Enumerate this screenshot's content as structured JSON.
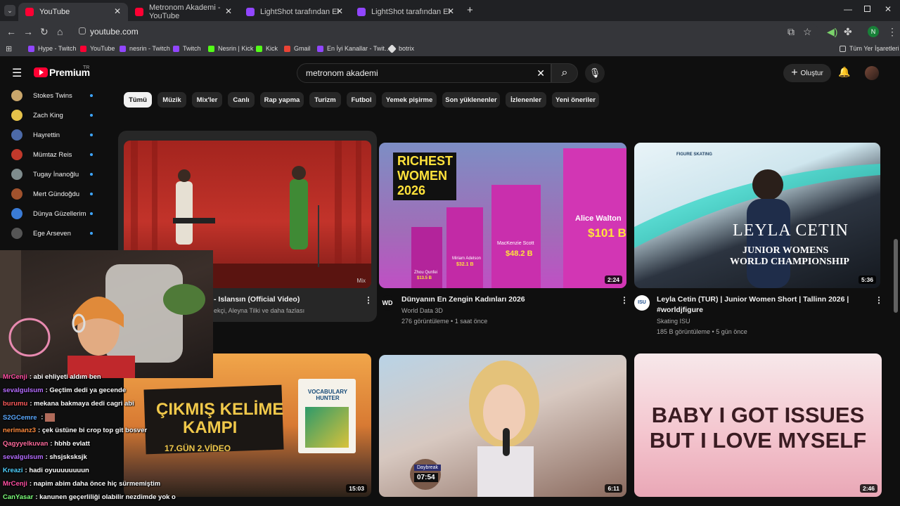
{
  "browser": {
    "tabs": [
      {
        "label": "YouTube",
        "color": "#ff0033",
        "active": true
      },
      {
        "label": "Metronom Akademi - YouTube",
        "color": "#ff0033",
        "active": false
      },
      {
        "label": "LightShot tarafından Ekran Gör…",
        "color": "#9146ff",
        "active": false
      },
      {
        "label": "LightShot tarafından Ekran Gör…",
        "color": "#9146ff",
        "active": false
      }
    ],
    "url": "youtube.com",
    "profile_initial": "N",
    "bookmarks": [
      {
        "label": "Hype - Twitch",
        "color": "#9146ff"
      },
      {
        "label": "YouTube",
        "color": "#ff0033"
      },
      {
        "label": "nesrin - Twitch",
        "color": "#9146ff"
      },
      {
        "label": "Twitch",
        "color": "#9146ff"
      },
      {
        "label": "Nesrin | Kick",
        "color": "#53fc18"
      },
      {
        "label": "Kick",
        "color": "#53fc18"
      },
      {
        "label": "Gmail",
        "color": "#ea4335"
      },
      {
        "label": "En İyi Kanallar - Twit…",
        "color": "#9146ff"
      },
      {
        "label": "botrix",
        "color": "#dddddd"
      }
    ],
    "all_bookmarks": "Tüm Yer İşaretleri"
  },
  "header": {
    "logo": "Premium",
    "country": "TR",
    "search_value": "metronom akademi",
    "create_label": "Oluştur"
  },
  "chips": [
    "Tümü",
    "Müzik",
    "Mix'ler",
    "Canlı",
    "Rap yapma",
    "Turizm",
    "Futbol",
    "Yemek pişirme",
    "Son yüklenenler",
    "İzlenenler",
    "Yeni öneriler"
  ],
  "sidebar": {
    "items": [
      {
        "label": "Stokes Twins",
        "color": "#c9a66b"
      },
      {
        "label": "Zach King",
        "color": "#e6c34a"
      },
      {
        "label": "Hayrettin",
        "color": "#4c6aa8"
      },
      {
        "label": "Mümtaz Reis",
        "color": "#c0392b"
      },
      {
        "label": "Tugay İnanoğlu",
        "color": "#7f8c8d"
      },
      {
        "label": "Mert Gündoğdu",
        "color": "#a0522d"
      },
      {
        "label": "Dünya Güzellerim",
        "color": "#3a7bd5"
      },
      {
        "label": "Ege Arseven",
        "color": "#555555"
      }
    ]
  },
  "videos": [
    {
      "title": "- Islansın (Official Video)",
      "channel": "",
      "meta": "ekçi, Aleyna Tilki ve daha fazlası",
      "duration": "",
      "badge": "Mix"
    },
    {
      "title": "Dünyanın En Zengin Kadınları 2026",
      "channel": "World Data 3D",
      "meta": "276 görüntüleme • 1 saat önce",
      "duration": "2:24",
      "channel_icon": "WD"
    },
    {
      "title": "Leyla Cetin (TUR) | Junior Women Short | Tallinn 2026 | #worldjfigure",
      "channel": "Skating ISU",
      "meta": "185 B görüntüleme • 5 gün önce",
      "duration": "5:36",
      "channel_icon": "ISU"
    },
    {
      "title": "",
      "channel": "",
      "meta": "",
      "duration": "15:03"
    },
    {
      "title": "",
      "channel": "",
      "meta": "",
      "duration": "6:11"
    },
    {
      "title": "",
      "channel": "",
      "meta": "",
      "duration": "2:46"
    }
  ],
  "thumb_text": {
    "richest": "RICHEST WOMEN 2026",
    "alice": "Alice Walton",
    "alice_val": "$101 B",
    "mackenzie": "MacKenzie Scott",
    "mackenzie_val": "$48.2 B",
    "miriam": "Miriam Adelson",
    "miriam_val": "$32.1 B",
    "zhou": "Zhou Qunfei",
    "zhou_val": "$13.5 B",
    "isu": "FIGURE SKATING",
    "leyla_name": "LEYLA CETIN",
    "leyla_sub1": "JUNIOR WOMENS",
    "leyla_sub2": "WORLD CHAMPIONSHIP",
    "kelime1": "ÇIKMIŞ KELİME",
    "kelime2": "KAMPI",
    "kelime3": "17.GÜN 2.VİDEO",
    "book": "VOCABULARY HUNTER",
    "daybreak": "Daybreak",
    "daybreak_time": "07:54",
    "baby1": "BABY I GOT ISSUES",
    "baby2": "BUT I LOVE MYSELF"
  },
  "chat": [
    {
      "user": "MrCenji",
      "text": "abi ehliyeti aldım ben",
      "color": "#ff4fa3"
    },
    {
      "user": "sevalgulsum",
      "text": "Geçtim dedi ya gecende",
      "color": "#b56cff"
    },
    {
      "user": "burumu",
      "text": "mekana bakmaya dedi cagri abi",
      "color": "#ff5b5b"
    },
    {
      "user": "S2GCemre",
      "text": ":",
      "color": "#5aa9ff"
    },
    {
      "user": "nerimanz3",
      "text": "çek üstüne bi crop top git bosver",
      "color": "#ff8a3d"
    },
    {
      "user": "Qagyyelkuvan",
      "text": "hbhb evlatt",
      "color": "#ff6b9d"
    },
    {
      "user": "sevalgulsum",
      "text": "shsjsksksjk",
      "color": "#b56cff"
    },
    {
      "user": "Kreazi",
      "text": "hadi oyuuuuuuuun",
      "color": "#4fd1ff"
    },
    {
      "user": "MrCenji",
      "text": "napim abim daha önce hiç sürmemiştim",
      "color": "#ff4fa3"
    },
    {
      "user": "CanYasar",
      "text": "kanunen geçerliliği olabilir nezdimde yok o",
      "color": "#7cff7a"
    }
  ]
}
